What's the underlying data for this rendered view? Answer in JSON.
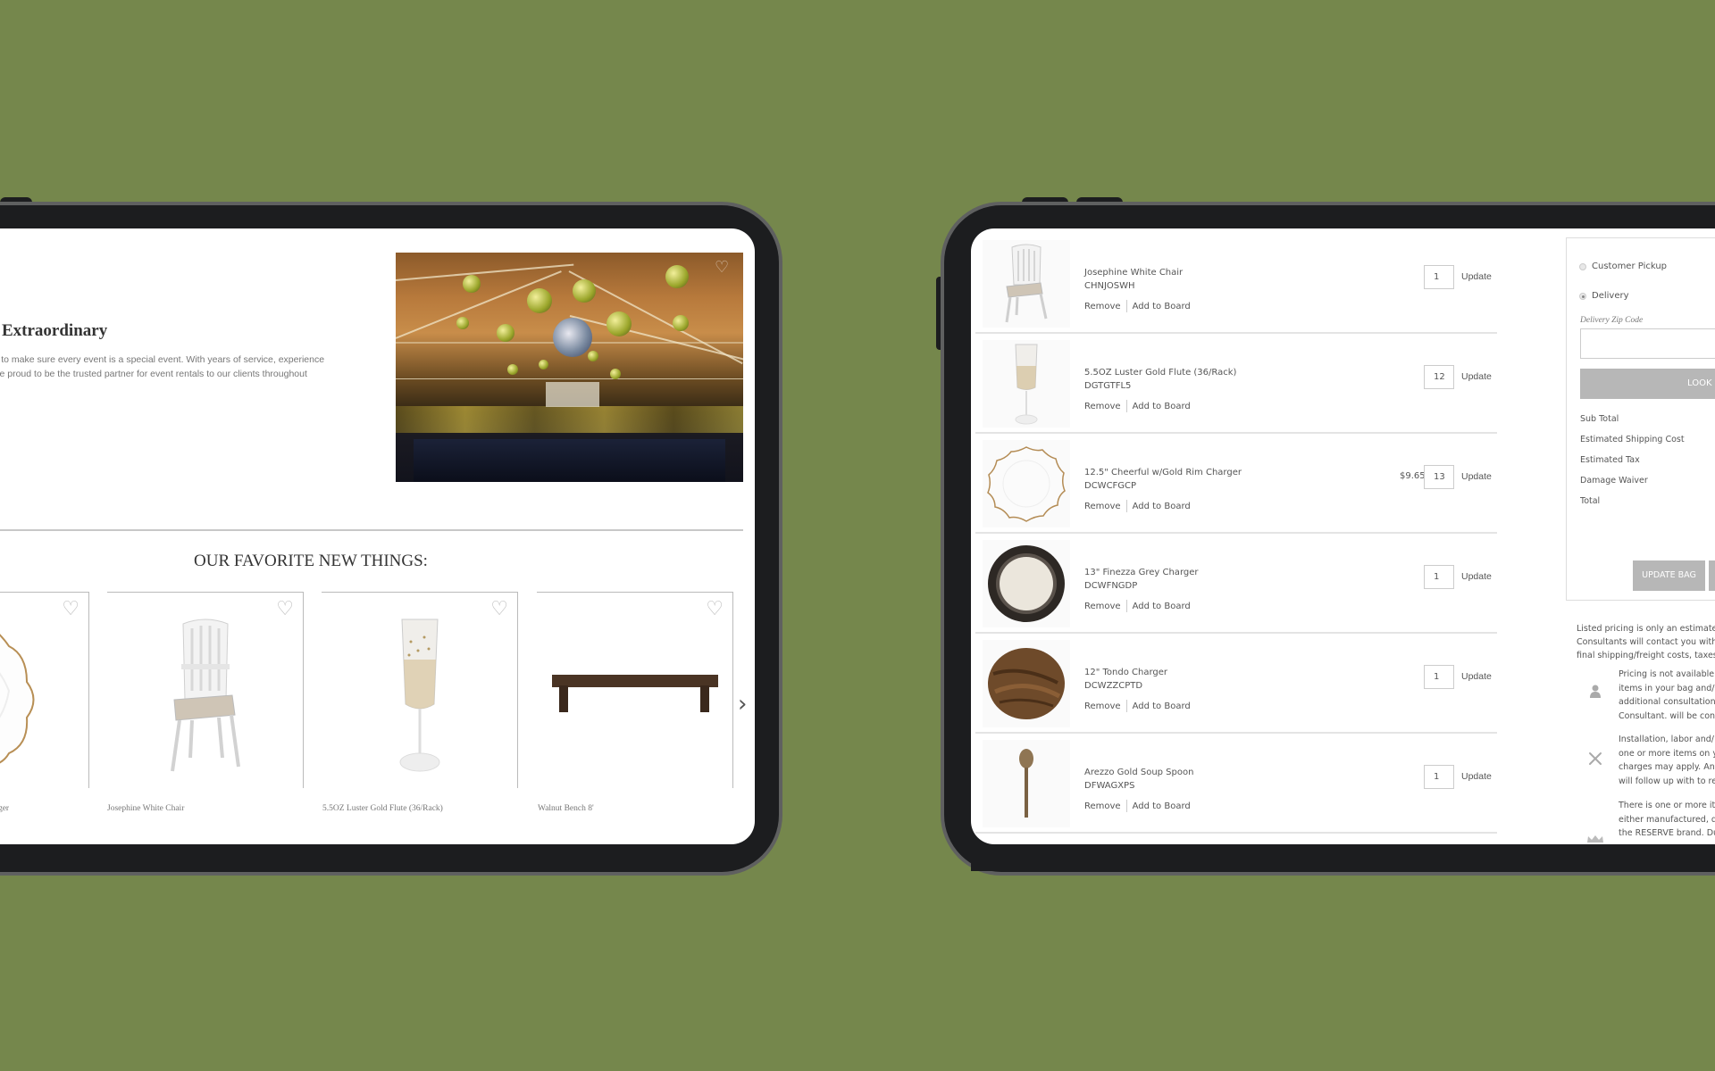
{
  "left_page": {
    "hero": {
      "title": "Extraordinary",
      "text_lines": [
        "l to make sure every event is a special event. With years of service, experience",
        "re proud to be the trusted partner for event rentals to our clients throughout"
      ],
      "image_alt": "Event venue with disco balls and dance floor",
      "favorite_icon": "heart-icon"
    },
    "favorites": {
      "title": "OUR FAVORITE NEW THINGS:",
      "items": [
        {
          "label": "harger",
          "image": "gold-rim-charger"
        },
        {
          "label": "Josephine White Chair",
          "image": "white-chair"
        },
        {
          "label": "5.5OZ Luster Gold Flute (36/Rack)",
          "image": "gold-flute"
        },
        {
          "label": "Walnut Bench 8'",
          "image": "walnut-bench"
        }
      ],
      "next_icon": "chevron-right-icon"
    }
  },
  "right_page": {
    "cart": {
      "remove_label": "Remove",
      "add_to_board_label": "Add to Board",
      "update_label": "Update",
      "items": [
        {
          "name": "Josephine White Chair",
          "sku": "CHNJOSWH",
          "qty": "1",
          "price": ""
        },
        {
          "name": "5.5OZ Luster Gold Flute (36/Rack)",
          "sku": "DGTGTFL5",
          "qty": "12",
          "price": ""
        },
        {
          "name": "12.5\" Cheerful w/Gold Rim Charger",
          "sku": "DCWCFGCP",
          "qty": "13",
          "price": "$9.65"
        },
        {
          "name": "13\" Finezza Grey Charger",
          "sku": "DCWFNGDP",
          "qty": "1",
          "price": ""
        },
        {
          "name": "12\" Tondo Charger",
          "sku": "DCWZZCPTD",
          "qty": "1",
          "price": ""
        },
        {
          "name": "Arezzo Gold Soup Spoon",
          "sku": "DFWAGXPS",
          "qty": "1",
          "price": ""
        }
      ]
    },
    "summary": {
      "pickup_label": "Customer Pickup",
      "delivery_label": "Delivery",
      "delivery_selected": true,
      "zip_label": "Delivery Zip Code",
      "zip_value": "",
      "lookup_label": "LOOK",
      "lines": [
        "Sub Total",
        "Estimated Shipping Cost",
        "Estimated Tax",
        "Damage Waiver",
        "Total"
      ],
      "update_bag_label": "UPDATE BAG"
    },
    "disclaimer_lines": [
      "Listed pricing is only an estimate.",
      "Consultants will contact you with",
      "final shipping/freight costs, taxes,"
    ],
    "notes": [
      {
        "icon": "user-icon",
        "lines": [
          "Pricing is not available",
          "items in your bag and/",
          "additional consultation",
          "Consultant. will be cont"
        ]
      },
      {
        "icon": "tools-icon",
        "lines": [
          "Installation, labor and/",
          "one or more items on y",
          "charges may apply. An",
          "will follow up with to re"
        ]
      },
      {
        "icon": "crown-icon",
        "lines": [
          "There is one or more it",
          "either manufactured, d",
          "the RESERVE brand. Du"
        ]
      }
    ]
  }
}
